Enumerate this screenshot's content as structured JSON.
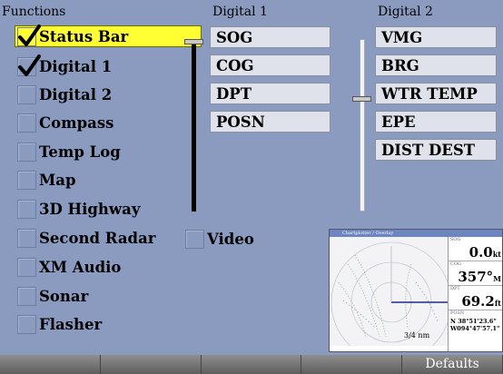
{
  "headers": {
    "functions": "Functions",
    "digital1": "Digital 1",
    "digital2": "Digital 2"
  },
  "functions": [
    {
      "label": "Status Bar",
      "checked": true,
      "selected": true
    },
    {
      "label": "Digital 1",
      "checked": true,
      "selected": false
    },
    {
      "label": "Digital 2",
      "checked": false,
      "selected": false
    },
    {
      "label": "Compass",
      "checked": false,
      "selected": false
    },
    {
      "label": "Temp Log",
      "checked": false,
      "selected": false
    },
    {
      "label": "Map",
      "checked": false,
      "selected": false
    },
    {
      "label": "3D Highway",
      "checked": false,
      "selected": false
    },
    {
      "label": "Second Radar",
      "checked": false,
      "selected": false
    },
    {
      "label": "XM Audio",
      "checked": false,
      "selected": false
    },
    {
      "label": "Sonar",
      "checked": false,
      "selected": false
    },
    {
      "label": "Flasher",
      "checked": false,
      "selected": false
    }
  ],
  "video": {
    "label": "Video",
    "checked": false
  },
  "digital1_fields": [
    "SOG",
    "COG",
    "DPT",
    "POSN"
  ],
  "digital2_fields": [
    "VMG",
    "BRG",
    "WTR TEMP",
    "EPE",
    "DIST DEST"
  ],
  "preview": {
    "title": "Chartplotter / Overlay",
    "cells": [
      {
        "caption": "SOG",
        "value": "0.0",
        "unit": "kt"
      },
      {
        "caption": "COG",
        "value": "357°",
        "unit": "M"
      },
      {
        "caption": "DPT",
        "value": "69.2",
        "unit": "ft"
      }
    ],
    "posn_caption": "POSN",
    "posn_lat": "N 38°51'23.6\"",
    "posn_lon": "W094°47'57.1\"",
    "scale": "3/4 nm"
  },
  "softkeys": [
    "",
    "",
    "",
    "",
    "Defaults"
  ],
  "colors": {
    "background": "#8b9bc0",
    "selected": "#ffff33",
    "field": "#dfe2ea"
  }
}
